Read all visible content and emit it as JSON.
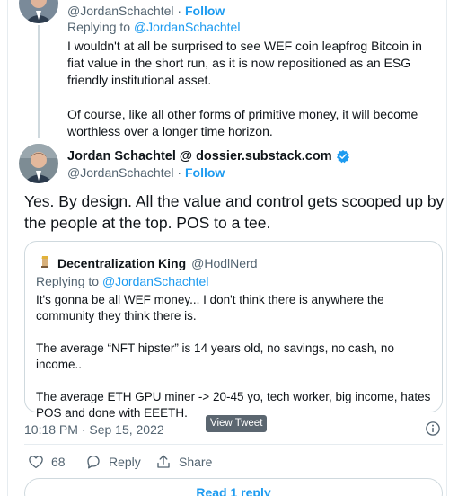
{
  "previous_tweet": {
    "handle": "@JordanSchachtel",
    "separator": "·",
    "follow_label": "Follow",
    "replying_prefix": "Replying to",
    "replying_to": "@JordanSchachtel",
    "paragraphs": [
      "I wouldn't at all be surprised to see WEF coin leapfrog Bitcoin in fiat value in the short run, as it is now repositioned as an ESG friendly institutional asset.",
      "Of course, like all other forms of primitive money, it will become worthless over a longer time horizon."
    ]
  },
  "main_tweet": {
    "author_name": "Jordan Schachtel @ dossier.substack.com",
    "handle": "@JordanSchachtel",
    "separator": "·",
    "follow_label": "Follow",
    "text": "Yes. By design. All the value and control gets scooped up by the people at the top. POS to a tee.",
    "timestamp": "10:18 PM · Sep 15, 2022",
    "tooltip": "View Tweet",
    "like_count": "68",
    "reply_label": "Reply",
    "share_label": "Share",
    "read_replies_label": "Read 1 reply"
  },
  "quoted_tweet": {
    "author_name": "Decentralization King",
    "handle": "@HodlNerd",
    "replying_prefix": "Replying to",
    "replying_to": "@JordanSchachtel",
    "paragraphs": [
      "It's gonna be all WEF money... I don't think there is anywhere the community they think there is.",
      "The average “NFT hipster” is 14 years old, no savings, no cash, no income..",
      "The average ETH GPU miner -> 20-45 yo, tech worker, big income, hates POS and done with EEETH."
    ]
  },
  "colors": {
    "accent": "#1d9bf0",
    "secondary_text": "#536471",
    "border": "#cfd9de"
  }
}
